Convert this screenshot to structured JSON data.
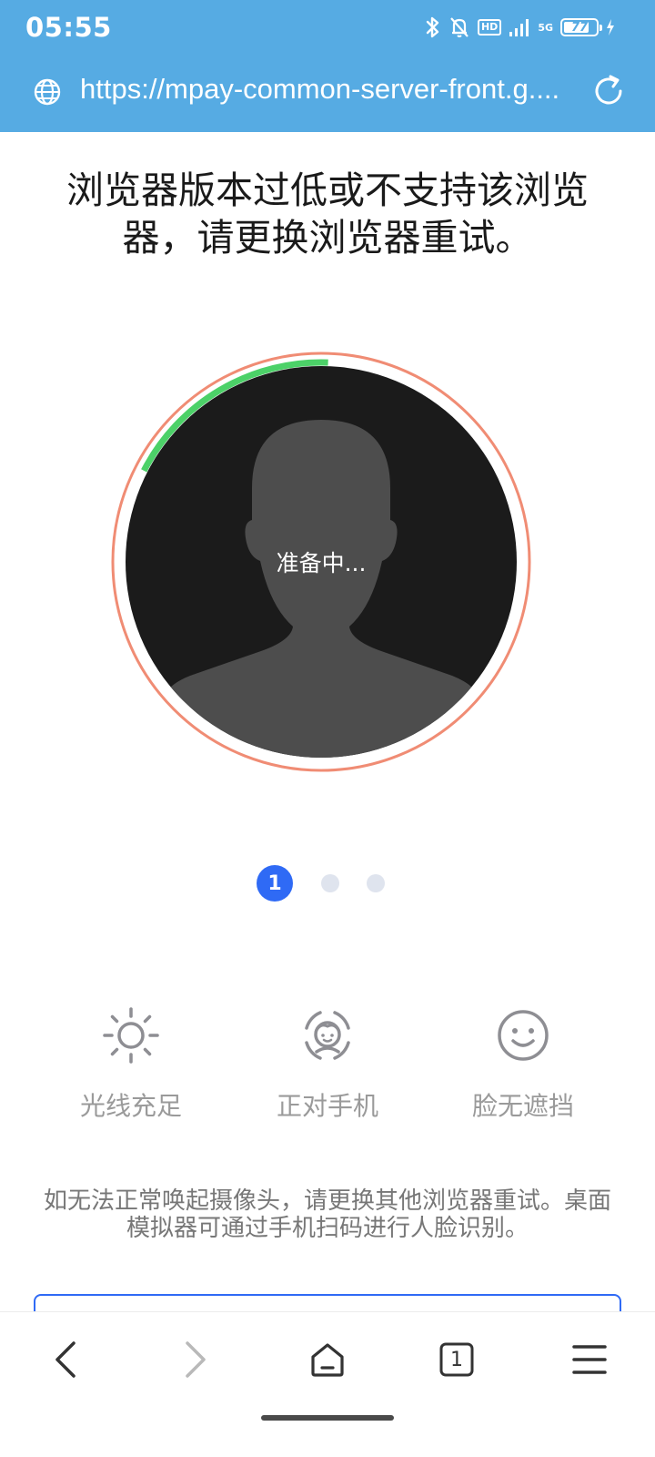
{
  "status_bar": {
    "time": "05:55",
    "hd_label": "HD",
    "network_label": "5G",
    "battery": "77"
  },
  "address_bar": {
    "url": "https://mpay-common-server-front.g...."
  },
  "headline": "浏览器版本过低或不支持该浏览器，请更换浏览器重试。",
  "face_scan": {
    "status_text": "准备中...",
    "progress_fraction": 0.18,
    "colors": {
      "ring": "#f08c74",
      "progress": "#4cd168",
      "background": "#1b1b1b",
      "silhouette": "#4d4d4d"
    }
  },
  "steps": {
    "active_label": "1"
  },
  "tips": [
    {
      "icon": "sun-icon",
      "label": "光线充足"
    },
    {
      "icon": "face-front-icon",
      "label": "正对手机"
    },
    {
      "icon": "smile-icon",
      "label": "脸无遮挡"
    }
  ],
  "help_text": "如无法正常唤起摄像头，请更换其他浏览器重试。桌面模拟器可通过手机扫码进行人脸识别。",
  "bottom_nav": {
    "tab_count": "1"
  }
}
